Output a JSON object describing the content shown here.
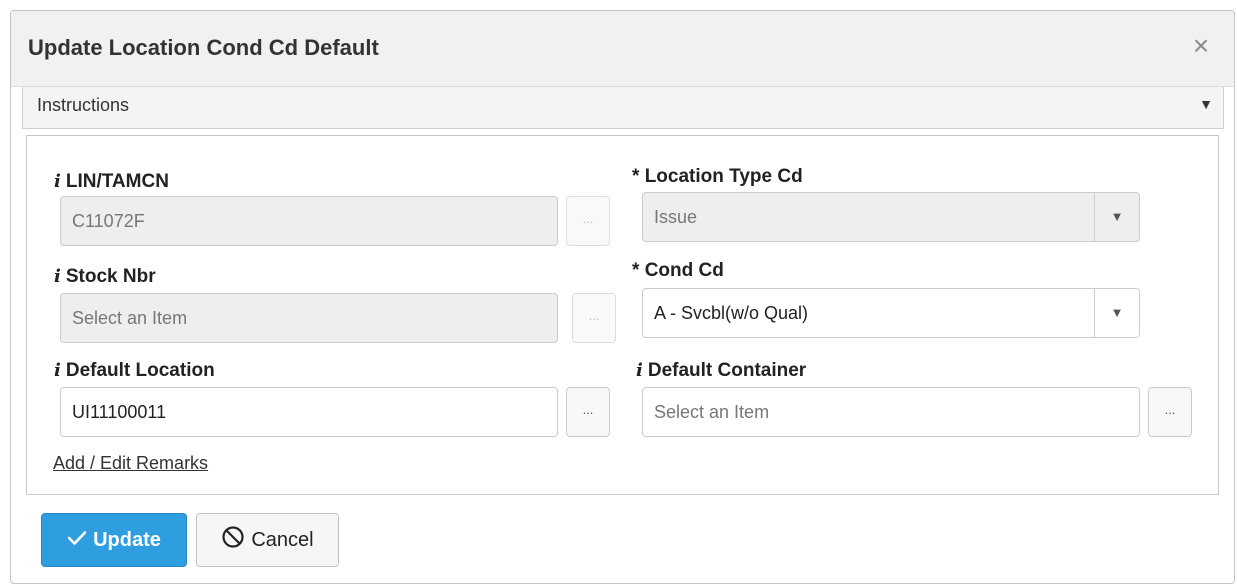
{
  "dialog": {
    "title": "Update Location Cond Cd Default",
    "close_glyph": "×"
  },
  "instructions": {
    "label": "Instructions",
    "caret_glyph": "▼"
  },
  "form": {
    "info_glyph": "i",
    "required_marker": "*",
    "ellipsis_glyph": "...",
    "caret_glyph": "▼",
    "lin_tamcn": {
      "label": "LIN/TAMCN",
      "value": "C11072F",
      "disabled": true
    },
    "stock_nbr": {
      "label": "Stock Nbr",
      "placeholder": "Select an Item",
      "disabled": true
    },
    "default_location": {
      "label": "Default Location",
      "value": "UI11100011"
    },
    "location_type_cd": {
      "label": "Location Type Cd",
      "value": "Issue",
      "required": true,
      "disabled": true
    },
    "cond_cd": {
      "label": "Cond Cd",
      "value": "A - Svcbl(w/o Qual)",
      "required": true
    },
    "default_container": {
      "label": "Default Container",
      "placeholder": "Select an Item"
    },
    "remarks_link": "Add / Edit Remarks"
  },
  "buttons": {
    "update_label": "Update",
    "cancel_label": "Cancel"
  },
  "icons": {
    "close": "close-icon",
    "caret": "chevron-down-icon",
    "info": "info-icon",
    "update": "checkmark-icon",
    "cancel": "prohibited-icon"
  },
  "colors": {
    "primary_button": "#2e9ee0",
    "title_bar": "#f1f1f1",
    "disabled_field": "#eeeeee"
  }
}
